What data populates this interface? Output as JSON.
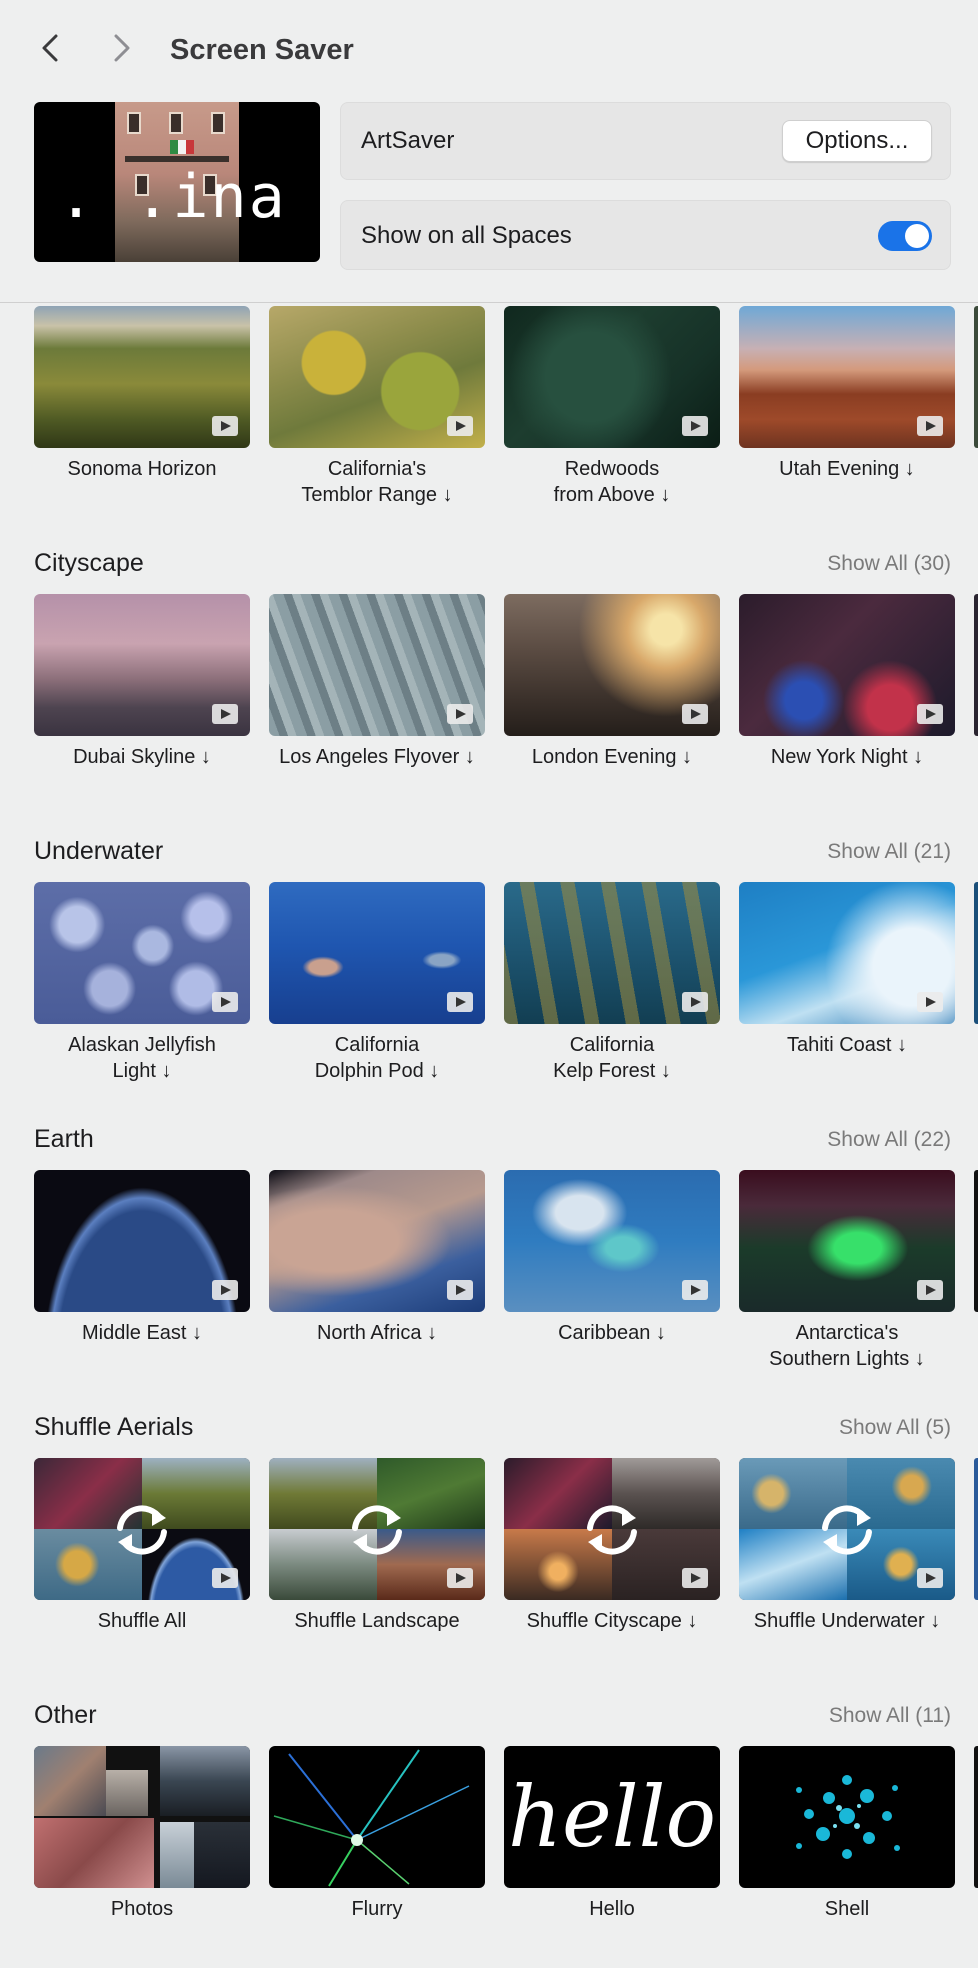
{
  "header": {
    "title": "Screen Saver",
    "preview_text": ". .ina"
  },
  "settings": {
    "saver_name": "ArtSaver",
    "options_label": "Options...",
    "spaces_label": "Show on all Spaces",
    "spaces_enabled": true
  },
  "colors": {
    "accent": "#1a73e8",
    "background": "#eeefef"
  },
  "landscape": {
    "items": [
      {
        "label": "Sonoma Horizon",
        "icon": "play-icon"
      },
      {
        "label": "California's\nTemblor Range ↓",
        "icon": "play-icon"
      },
      {
        "label": "Redwoods\nfrom Above ↓",
        "icon": "play-icon"
      },
      {
        "label": "Utah Evening ↓",
        "icon": "play-icon"
      }
    ]
  },
  "cityscape": {
    "title": "Cityscape",
    "show_all": "Show All (30)",
    "items": [
      {
        "label": "Dubai Skyline ↓"
      },
      {
        "label": "Los Angeles Flyover ↓"
      },
      {
        "label": "London Evening ↓"
      },
      {
        "label": "New York Night ↓"
      }
    ]
  },
  "underwater": {
    "title": "Underwater",
    "show_all": "Show All (21)",
    "items": [
      {
        "label": "Alaskan Jellyfish\nLight ↓"
      },
      {
        "label": "California\nDolphin Pod ↓"
      },
      {
        "label": "California\nKelp Forest ↓"
      },
      {
        "label": "Tahiti Coast ↓"
      }
    ]
  },
  "earth": {
    "title": "Earth",
    "show_all": "Show All (22)",
    "items": [
      {
        "label": "Middle East ↓"
      },
      {
        "label": "North Africa ↓"
      },
      {
        "label": "Caribbean ↓"
      },
      {
        "label": "Antarctica's\nSouthern Lights ↓"
      }
    ]
  },
  "shuffle": {
    "title": "Shuffle Aerials",
    "show_all": "Show All (5)",
    "items": [
      {
        "label": "Shuffle All"
      },
      {
        "label": "Shuffle Landscape"
      },
      {
        "label": "Shuffle Cityscape ↓"
      },
      {
        "label": "Shuffle Underwater ↓"
      }
    ]
  },
  "other": {
    "title": "Other",
    "show_all": "Show All (11)",
    "hello_text": "hello",
    "items": [
      {
        "label": "Photos"
      },
      {
        "label": "Flurry"
      },
      {
        "label": "Hello"
      },
      {
        "label": "Shell"
      }
    ]
  }
}
